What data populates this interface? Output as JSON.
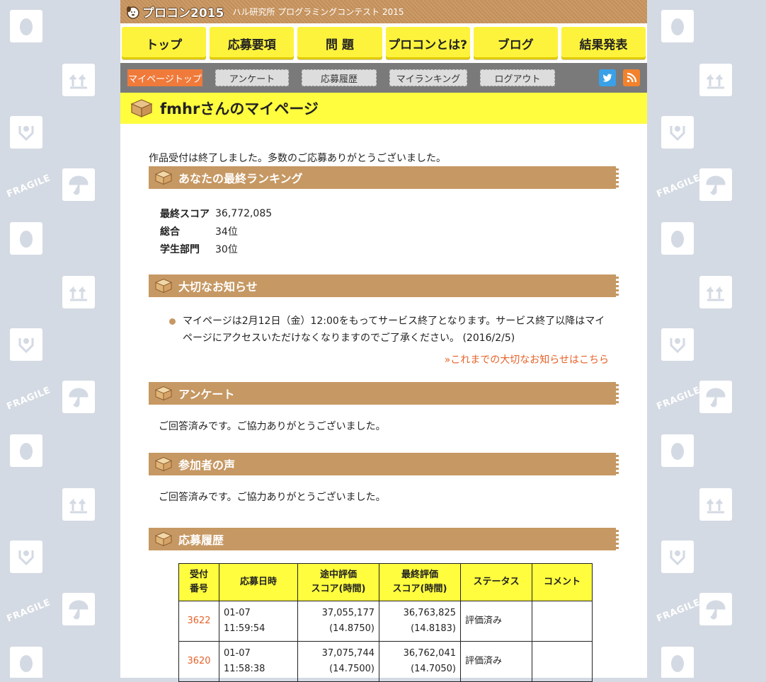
{
  "header": {
    "logo_text": "プロコン2015",
    "subtitle": "ハル研究所 プログラミングコンテスト 2015"
  },
  "main_nav": {
    "items": [
      {
        "label": "トップ"
      },
      {
        "label": "応募要項"
      },
      {
        "label": "問 題"
      },
      {
        "label": "プロコンとは?"
      },
      {
        "label": "ブログ"
      },
      {
        "label": "結果発表"
      }
    ]
  },
  "sub_nav": {
    "items": [
      {
        "label": "マイページトップ",
        "active": true
      },
      {
        "label": "アンケート"
      },
      {
        "label": "応募履歴"
      },
      {
        "label": "マイランキング"
      },
      {
        "label": "ログアウト"
      }
    ]
  },
  "page_title": "fmhrさんのマイページ",
  "closed_notice": "作品受付は終了しました。多数のご応募ありがとうございました。",
  "ranking": {
    "heading": "あなたの最終ランキング",
    "rows": [
      {
        "key": "最終スコア",
        "value": "36,772,085"
      },
      {
        "key": "総合",
        "value": "34位"
      },
      {
        "key": "学生部門",
        "value": "30位"
      }
    ]
  },
  "important": {
    "heading": "大切なお知らせ",
    "item": "マイページは2月12日（金）12:00をもってサービス終了となります。サービス終了以降はマイページにアクセスいただけなくなりますのでご了承ください。 (2016/2/5)",
    "more_link": "»これまでの大切なお知らせはこちら"
  },
  "survey": {
    "heading": "アンケート",
    "text": "ご回答済みです。ご協力ありがとうございました。"
  },
  "voices": {
    "heading": "参加者の声",
    "text": "ご回答済みです。ご協力ありがとうございました。"
  },
  "history": {
    "heading": "応募履歴",
    "columns": [
      "受付番号",
      "応募日時",
      "途中評価スコア(時間)",
      "最終評価スコア(時間)",
      "ステータス",
      "コメント"
    ],
    "column_lines": [
      [
        "受付",
        "番号"
      ],
      [
        "応募日時"
      ],
      [
        "途中評価",
        "スコア(時間)"
      ],
      [
        "最終評価",
        "スコア(時間)"
      ],
      [
        "ステータス"
      ],
      [
        "コメント"
      ]
    ],
    "rows": [
      {
        "id": "3622",
        "date": "01-07",
        "time": "11:59:54",
        "mid_score": "37,055,177",
        "mid_time": "(14.8750)",
        "final_score": "36,763,825",
        "final_time": "(14.8183)",
        "status": "評価済み",
        "comment": ""
      },
      {
        "id": "3620",
        "date": "01-07",
        "time": "11:58:38",
        "mid_score": "37,075,744",
        "mid_time": "(14.7500)",
        "final_score": "36,762,041",
        "final_time": "(14.7050)",
        "status": "評価済み",
        "comment": ""
      }
    ]
  },
  "colors": {
    "yellow": "#fffd3d",
    "brown": "#c69863",
    "orange": "#f07a3a",
    "link": "#e6632a"
  }
}
